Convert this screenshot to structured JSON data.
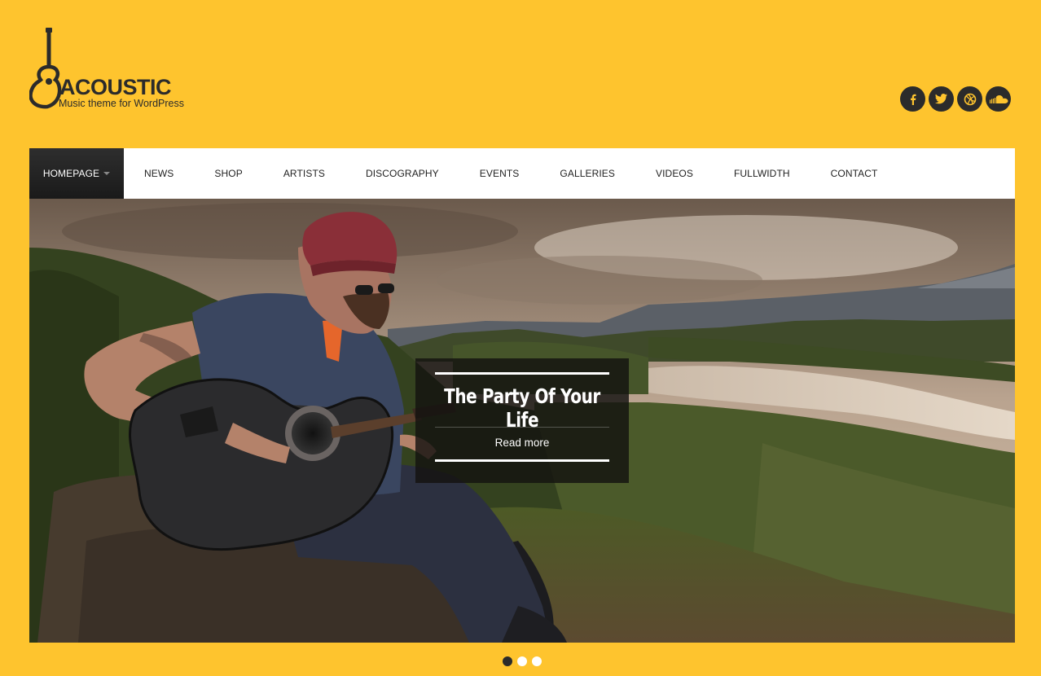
{
  "logo": {
    "title": "ACOUSTIC",
    "tagline": "Music theme for WordPress"
  },
  "social": [
    {
      "icon": "facebook-icon",
      "label": "f"
    },
    {
      "icon": "twitter-icon",
      "label": "twitter"
    },
    {
      "icon": "dribbble-icon",
      "label": "dribbble"
    },
    {
      "icon": "soundcloud-icon",
      "label": "soundcloud"
    }
  ],
  "nav": {
    "items": [
      {
        "label": "HOMEPAGE",
        "active": true
      },
      {
        "label": "NEWS"
      },
      {
        "label": "SHOP"
      },
      {
        "label": "ARTISTS"
      },
      {
        "label": "DISCOGRAPHY"
      },
      {
        "label": "EVENTS"
      },
      {
        "label": "GALLERIES"
      },
      {
        "label": "VIDEOS"
      },
      {
        "label": "FULLWIDTH"
      },
      {
        "label": "CONTACT"
      }
    ]
  },
  "slider": {
    "caption_title": "The Party Of Your Life",
    "caption_link": "Read more",
    "slide_count": 3,
    "active_slide": 1
  },
  "colors": {
    "background": "#fec42e",
    "dark": "#2b2b2b",
    "nav_active": "#1e1e1e"
  }
}
